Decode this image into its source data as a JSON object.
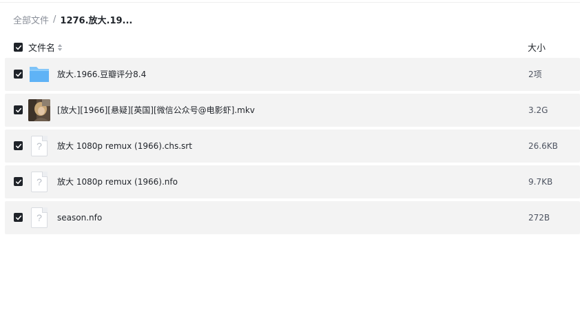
{
  "breadcrumb": {
    "root": "全部文件",
    "separator": "/",
    "current": "1276.放大.19..."
  },
  "header": {
    "name_label": "文件名",
    "size_label": "大小",
    "sort_icon": "sort-icon"
  },
  "files": [
    {
      "name": "放大.1966.豆瓣评分8.4",
      "size": "2项",
      "icon": "folder-icon"
    },
    {
      "name": "[放大][1966][悬疑][英国][微信公众号@电影虾].mkv",
      "size": "3.2G",
      "icon": "video-thumbnail"
    },
    {
      "name": "放大 1080p remux (1966).chs.srt",
      "size": "26.6KB",
      "icon": "unknown-file-icon"
    },
    {
      "name": "放大 1080p remux (1966).nfo",
      "size": "9.7KB",
      "icon": "unknown-file-icon"
    },
    {
      "name": "season.nfo",
      "size": "272B",
      "icon": "unknown-file-icon"
    }
  ],
  "unknown_file_glyph": "?",
  "colors": {
    "row_bg": "#f3f3f3",
    "checkbox": "#1f2329",
    "folder": "#5fb3f6",
    "muted_text": "#8a8f99"
  }
}
